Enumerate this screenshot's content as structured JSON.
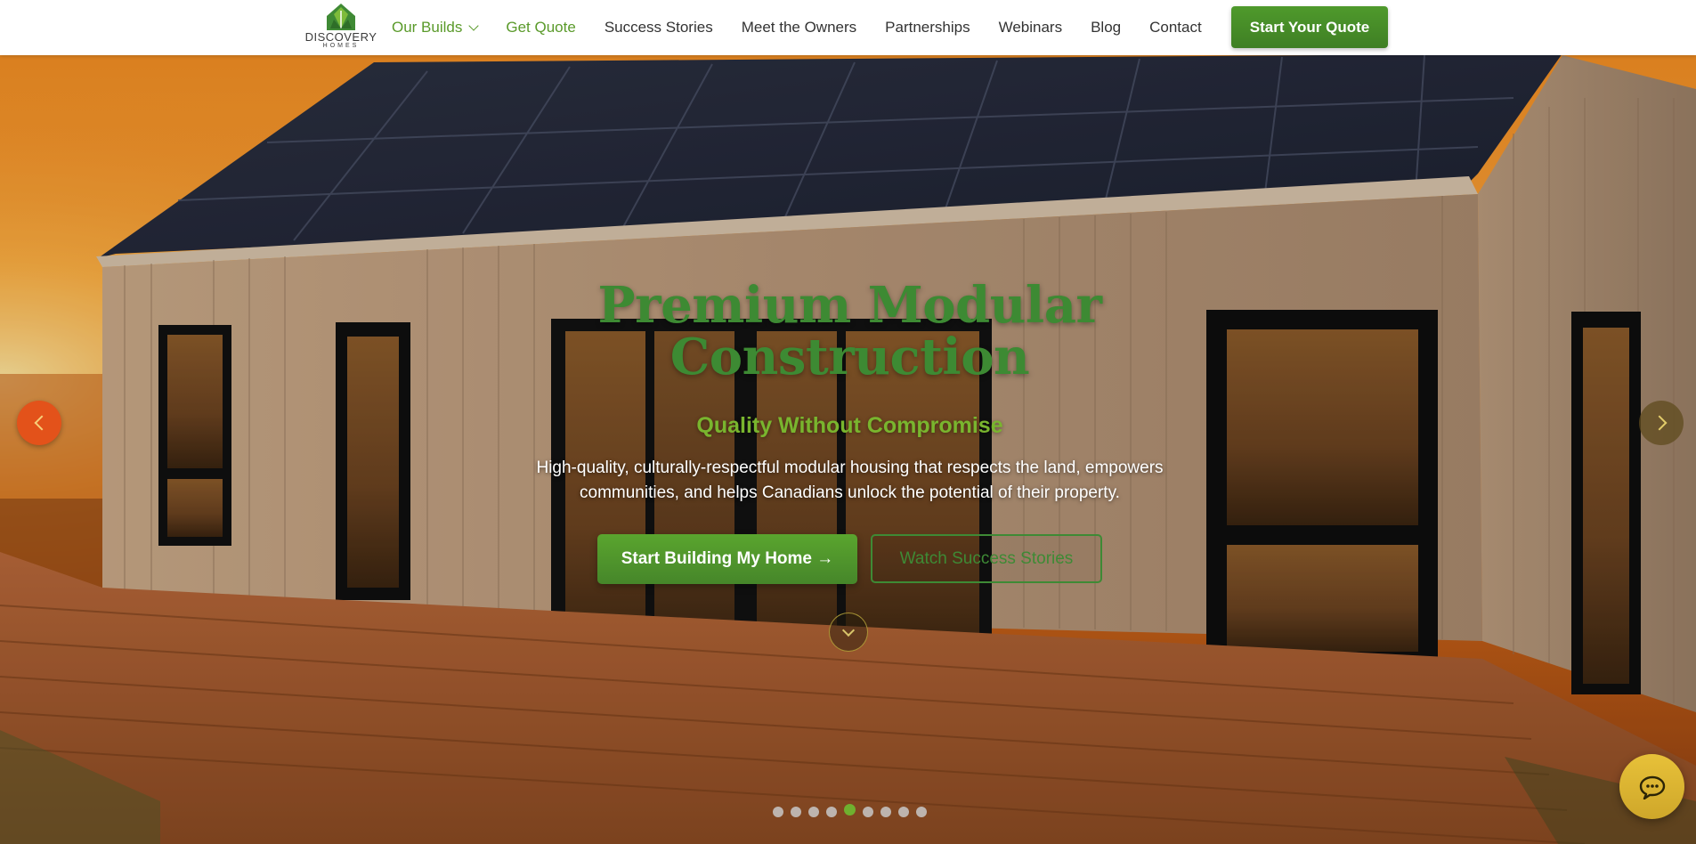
{
  "header": {
    "logo_text": "DISCOVERY",
    "logo_sub": "HOMES",
    "nav": [
      {
        "label": "Our Builds",
        "has_dropdown": true,
        "active": true
      },
      {
        "label": "Get Quote",
        "active": true
      },
      {
        "label": "Success Stories"
      },
      {
        "label": "Meet the Owners"
      },
      {
        "label": "Partnerships"
      },
      {
        "label": "Webinars"
      },
      {
        "label": "Blog"
      },
      {
        "label": "Contact"
      }
    ],
    "cta_label": "Start Your Quote"
  },
  "hero": {
    "title_line1": "Premium Modular",
    "title_line2": "Construction",
    "subtitle": "Quality Without Compromise",
    "description": "High-quality, culturally-respectful modular housing that respects the land, empowers communities, and helps Canadians unlock the potential of their property.",
    "primary_button": "Start Building My Home →",
    "secondary_button": "Watch Success Stories",
    "slides_total": 9,
    "active_slide": 5
  },
  "colors": {
    "brand_green": "#4f9a2c",
    "title_green": "#3d8a33",
    "subtitle_green": "#79b52e",
    "arrow_orange": "#e3521a",
    "chat_gold": "#e7c139"
  },
  "icons": {
    "prev": "chevron-left-icon",
    "next": "chevron-right-icon",
    "scroll": "chevron-down-icon",
    "chat": "chat-bubble-icon",
    "logo": "house-leaf-logo"
  }
}
